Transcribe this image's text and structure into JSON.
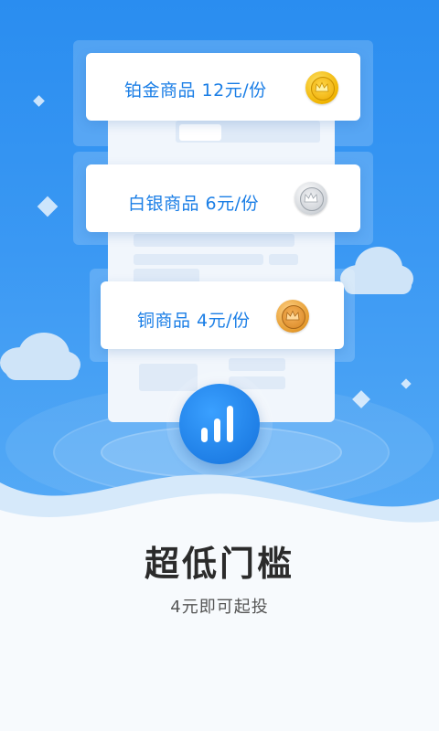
{
  "products": [
    {
      "label": "铂金商品  12元/份",
      "coin": "gold-crown-coin-icon"
    },
    {
      "label": "白银商品  6元/份",
      "coin": "silver-crown-coin-icon"
    },
    {
      "label": "铜商品  4元/份",
      "coin": "bronze-crown-coin-icon"
    }
  ],
  "center_icon": "bar-chart-icon",
  "headline": "超低门槛",
  "subheadline": "4元即可起投",
  "colors": {
    "brand_blue": "#2a8df0",
    "card_text": "#1a7ee6",
    "headline_text": "#2b2b2b",
    "subheadline_text": "#555555"
  }
}
